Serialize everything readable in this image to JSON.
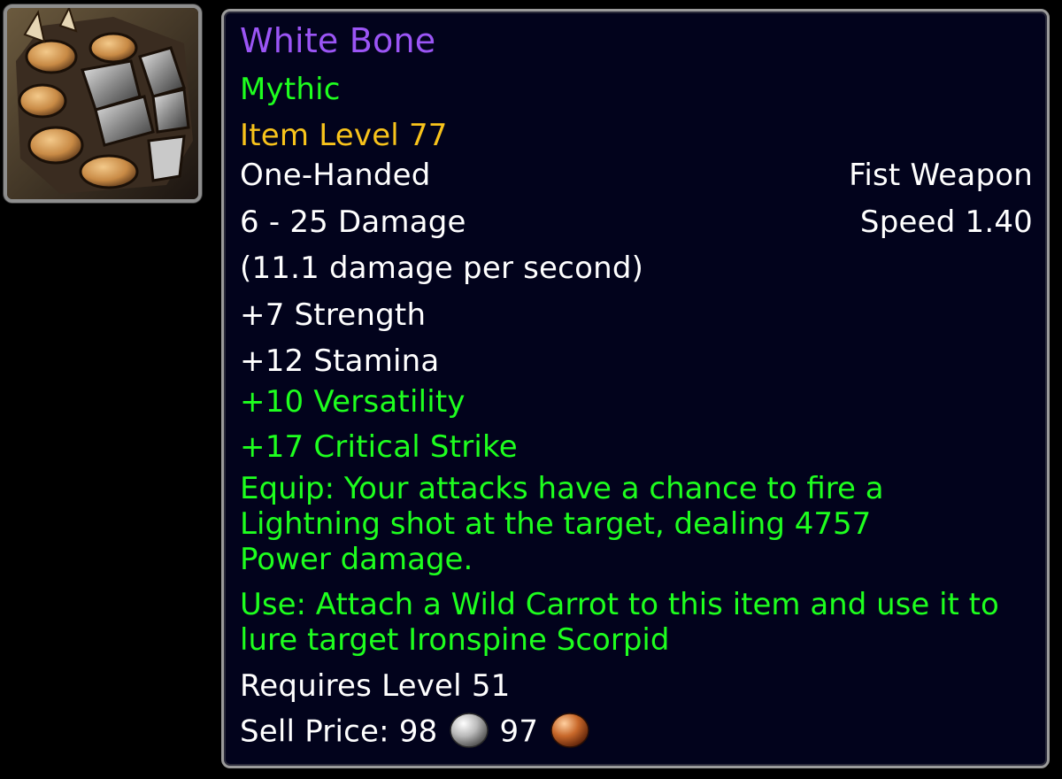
{
  "item": {
    "icon": "fist-weapon-icon",
    "name": "White Bone",
    "quality": "Mythic",
    "item_level": "Item Level 77",
    "slot": "One-Handed",
    "type": "Fist Weapon",
    "damage": "6 - 25 Damage",
    "speed": "Speed 1.40",
    "dps": "(11.1 damage per second)",
    "stats": {
      "strength": "+7 Strength",
      "stamina": "+12 Stamina",
      "versatility": "+10 Versatility",
      "critical_strike": "+17 Critical Strike"
    },
    "equip_effect": "Equip: Your attacks have a chance to fire a Lightning shot at the target, dealing 4757 Power damage.",
    "use_effect": "Use: Attach a Wild Carrot to this item and use it to lure target Ironspine Scorpid",
    "requirement": "Requires Level 51",
    "sell_price": {
      "label": "Sell Price:",
      "silver": "98",
      "copper": "97",
      "silver_icon": "silver-coin-icon",
      "copper_icon": "copper-coin-icon"
    }
  },
  "colors": {
    "name": "#9b55f5",
    "green": "#1eff1e",
    "item_level": "#f8c31b",
    "text": "#ffffff",
    "background": "#02031c"
  }
}
